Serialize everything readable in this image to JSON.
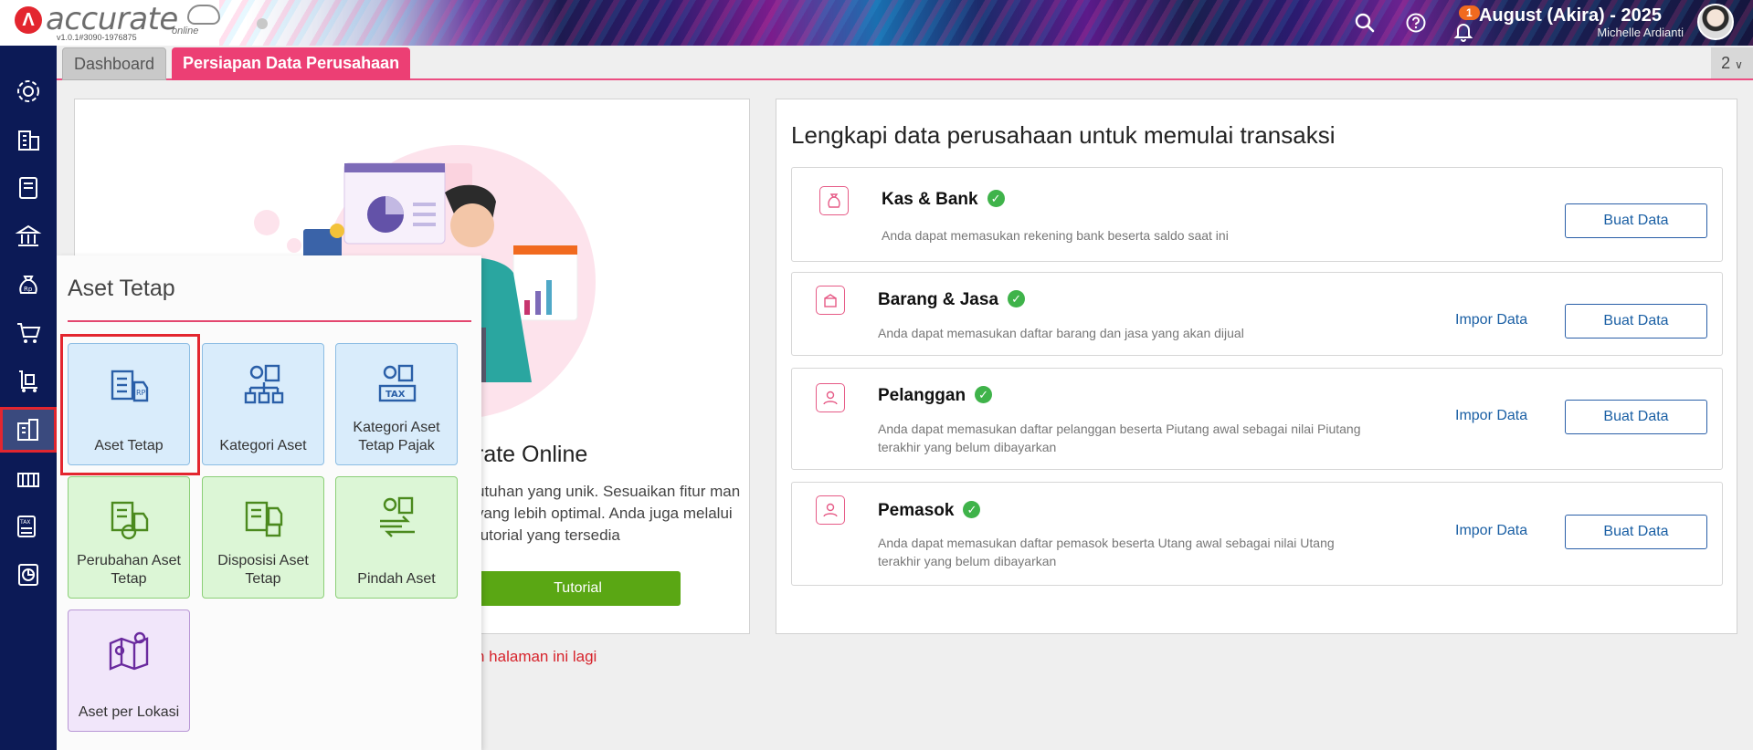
{
  "header": {
    "logo_text": "accurate",
    "logo_sub": "online",
    "version": "v1.0.1#3090-1976875",
    "notification_count": "1",
    "period": "August (Akira) - 2025",
    "user": "Michelle Ardianti"
  },
  "sidebar": {
    "items": [
      "gear-icon",
      "building-icon",
      "book-icon",
      "bank-icon",
      "money-bag-icon",
      "cart-icon",
      "trolley-icon",
      "fixed-asset-icon",
      "factory-icon",
      "tax-icon",
      "report-icon"
    ],
    "active": "fixed-asset-icon"
  },
  "tabs": {
    "dashboard": "Dashboard",
    "persiapan": "Persiapan Data Perusahaan",
    "count": "2"
  },
  "welcome": {
    "title_partial": "rate Online",
    "desc_partial": "utuhan yang unik. Sesuaikan fitur man yang lebih optimal. Anda juga melalui tutorial yang tersedia",
    "tutorial_label": "Tutorial",
    "hide_link_partial": "n halaman ini lagi"
  },
  "lengkapi": {
    "title": "Lengkapi data perusahaan untuk memulai transaksi",
    "cards": [
      {
        "title": "Kas & Bank",
        "desc": "Anda dapat memasukan rekening bank beserta saldo saat ini",
        "impor": "",
        "buat": "Buat Data"
      },
      {
        "title": "Barang & Jasa",
        "desc": "Anda dapat memasukan daftar barang dan jasa yang akan dijual",
        "impor": "Impor Data",
        "buat": "Buat Data"
      },
      {
        "title": "Pelanggan",
        "desc_line1": "Anda dapat memasukan daftar pelanggan beserta Piutang awal sebagai nilai Piutang",
        "desc_line2": "terakhir yang belum dibayarkan",
        "impor": "Impor Data",
        "buat": "Buat Data"
      },
      {
        "title": "Pemasok",
        "desc_line1": "Anda dapat memasukan daftar pemasok beserta Utang awal sebagai nilai Utang",
        "desc_line2": "terakhir yang belum dibayarkan",
        "impor": "Impor Data",
        "buat": "Buat Data"
      }
    ]
  },
  "popup": {
    "title": "Aset Tetap",
    "tiles": [
      {
        "label": "Aset Tetap",
        "icon": "fixed-asset-icon",
        "color": "blue"
      },
      {
        "label": "Kategori Aset",
        "icon": "asset-category-icon",
        "color": "blue"
      },
      {
        "label": "Kategori Aset Tetap Pajak",
        "icon": "tax-asset-category-icon",
        "color": "blue"
      },
      {
        "label": "Perubahan Aset Tetap",
        "icon": "asset-change-icon",
        "color": "green"
      },
      {
        "label": "Disposisi Aset Tetap",
        "icon": "asset-disposal-icon",
        "color": "green"
      },
      {
        "label": "Pindah Aset",
        "icon": "asset-transfer-icon",
        "color": "green"
      },
      {
        "label": "Aset per Lokasi",
        "icon": "location-map-icon",
        "color": "purple"
      }
    ]
  },
  "colors": {
    "sidebar": "#0c1a56",
    "accent": "#ec3f74",
    "link": "#1a5fa4",
    "green_button": "#5aa714"
  }
}
